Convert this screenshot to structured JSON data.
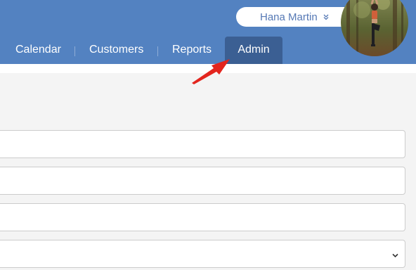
{
  "header": {
    "user_name": "Hana Martin",
    "user_menu_icon": "double-chevron-down-icon",
    "colors": {
      "header_bg": "#5382c1",
      "active_tab_bg": "#3b5f93",
      "arrow": "#e3251e"
    }
  },
  "nav": {
    "items": [
      {
        "label": "Calendar"
      },
      {
        "label": "Customers"
      },
      {
        "label": "Reports"
      },
      {
        "label": "Admin",
        "active": true
      }
    ]
  },
  "annotation": {
    "icon": "red-arrow-icon"
  },
  "form": {
    "fields": [
      {
        "type": "text",
        "value": ""
      },
      {
        "type": "text",
        "value": ""
      },
      {
        "type": "text",
        "value": ""
      },
      {
        "type": "select",
        "value": "",
        "icon": "chevron-down-icon"
      }
    ]
  }
}
